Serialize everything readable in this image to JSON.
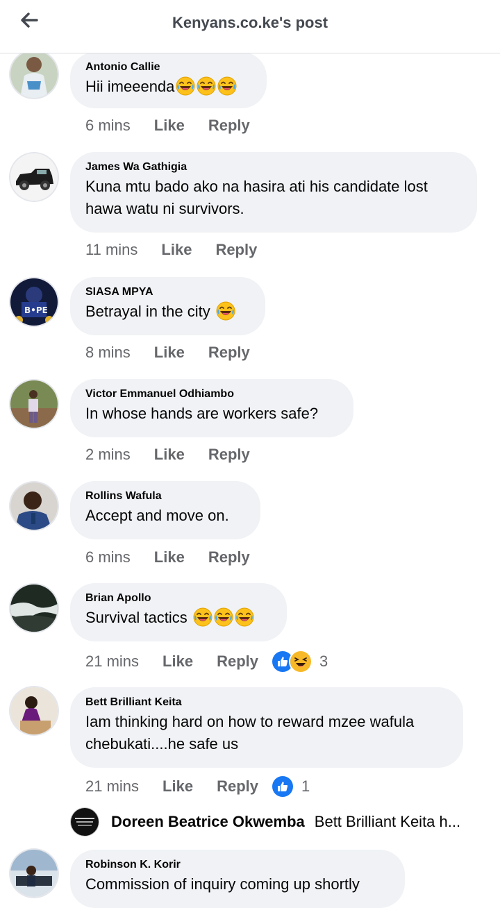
{
  "header": {
    "title": "Kenyans.co.ke's post",
    "back_icon": "arrow-left-icon"
  },
  "actions": {
    "like": "Like",
    "reply": "Reply"
  },
  "comments": [
    {
      "author": "Antonio Callie",
      "text": "Hii imeeenda",
      "emoji_count": 3,
      "time": "6 mins"
    },
    {
      "author": "James Wa Gathigia",
      "text": "Kuna mtu bado ako na hasira ati his candidate lost hawa watu ni survivors.",
      "time": "11 mins"
    },
    {
      "author": "SIASA MPYA",
      "text": "Betrayal in the city",
      "emoji_count": 1,
      "time": "8 mins"
    },
    {
      "author": "Victor Emmanuel Odhiambo",
      "text": "In whose hands are workers safe?",
      "time": "2 mins"
    },
    {
      "author": "Rollins Wafula",
      "text": "Accept and move on.",
      "time": "6 mins"
    },
    {
      "author": "Brian Apollo",
      "text": "Survival tactics",
      "emoji_count": 3,
      "time": "21 mins",
      "reaction_count": "3",
      "reactions": [
        "like",
        "haha"
      ]
    },
    {
      "author": "Bett Brilliant Keita",
      "text": "Iam thinking hard on how to reward mzee wafula chebukati....he safe us",
      "time": "21 mins",
      "reaction_count": "1",
      "reactions": [
        "like"
      ]
    },
    {
      "author": "Robinson K. Korir",
      "text": "Commission of inquiry coming up shortly"
    }
  ],
  "reply_preview": {
    "author": "Doreen Beatrice Okwemba",
    "text": "Bett Brilliant Keita h..."
  },
  "colors": {
    "bubble": "#f0f2f5",
    "meta": "#65676b",
    "like_blue": "#1877f2",
    "haha_yellow": "#f7b928"
  }
}
